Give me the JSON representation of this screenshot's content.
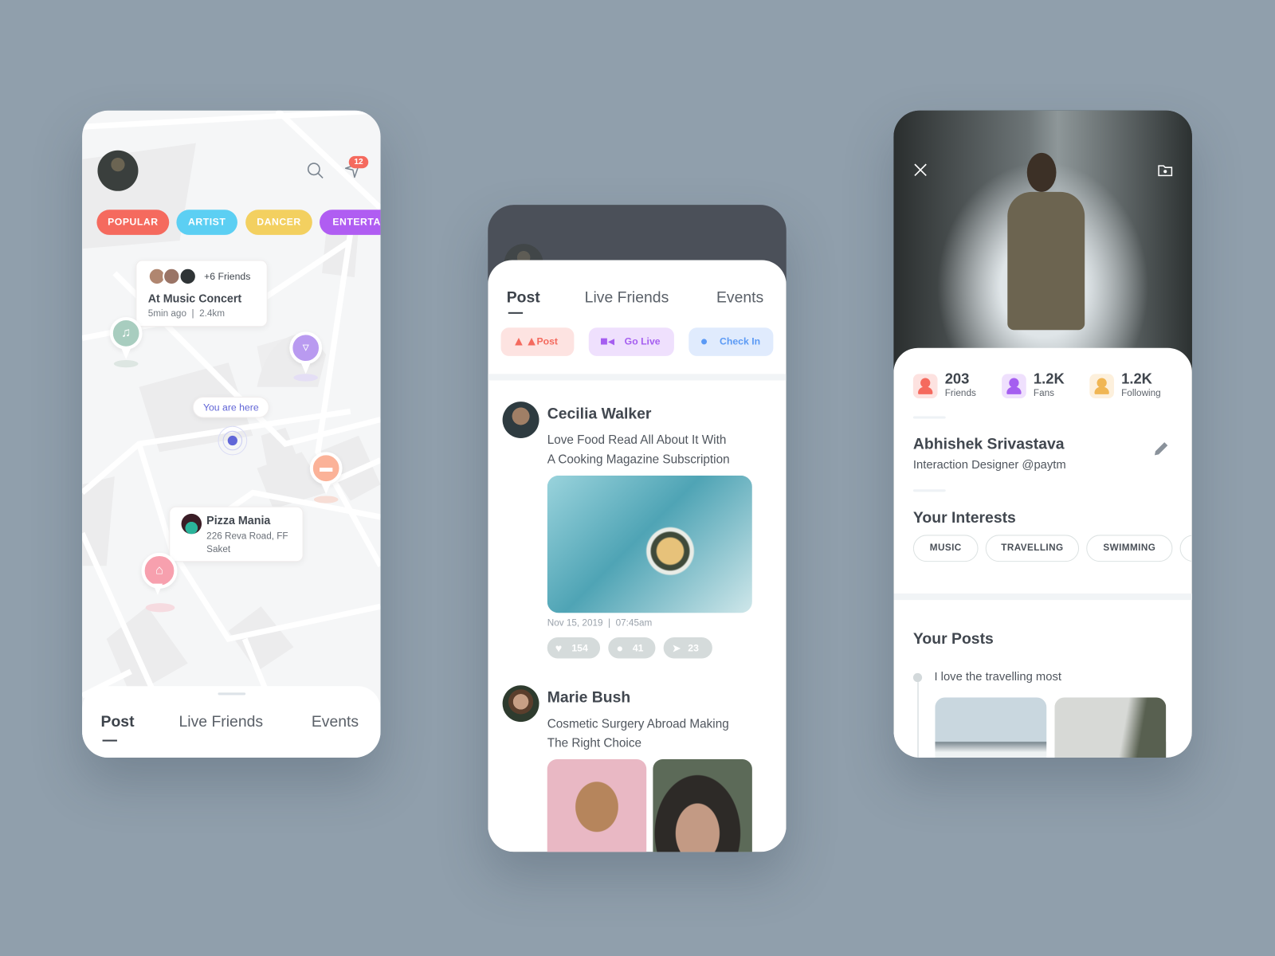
{
  "map_screen": {
    "notification_count": "12",
    "categories": [
      {
        "label": "POPULAR",
        "color": "#f56a5e"
      },
      {
        "label": "ARTIST",
        "color": "#5ccff3"
      },
      {
        "label": "DANCER",
        "color": "#f3d060"
      },
      {
        "label": "ENTERTAN",
        "color": "#b05df2"
      }
    ],
    "friends_card": {
      "extra_friends": "+6 Friends",
      "title": "At Music Concert",
      "meta": "5min ago  |  2.4km"
    },
    "you_are_here": "You are here",
    "place_card": {
      "title": "Pizza Mania",
      "address_line1": "226 Reva Road, FF",
      "address_line2": "Saket"
    },
    "tabs": [
      "Post",
      "Live Friends",
      "Events"
    ],
    "active_tab": "Post"
  },
  "feed_screen": {
    "tabs": [
      "Post",
      "Live Friends",
      "Events"
    ],
    "active_tab": "Post",
    "actions": [
      {
        "label": "Post",
        "icon": "mountain-icon",
        "color": "#f46a5e",
        "bg": "#fde3e1"
      },
      {
        "label": "Go Live",
        "icon": "video-icon",
        "color": "#a55ef0",
        "bg": "#efe0fd"
      },
      {
        "label": "Check In",
        "icon": "location-pin-icon",
        "color": "#5b9af5",
        "bg": "#e0ebfd"
      }
    ],
    "posts": [
      {
        "author": "Cecilia Walker",
        "text_line1": "Love Food Read All About It With",
        "text_line2": "A Cooking Magazine Subscription",
        "date": "Nov 15, 2019  |  07:45am",
        "likes": "154",
        "comments": "41",
        "shares": "23"
      },
      {
        "author": "Marie Bush",
        "text_line1": "Cosmetic Surgery Abroad Making",
        "text_line2": "The Right Choice"
      }
    ]
  },
  "profile_screen": {
    "stats": [
      {
        "value": "203",
        "label": "Friends",
        "color": "#f56a5e",
        "bg": "#fde2e0"
      },
      {
        "value": "1.2K",
        "label": "Fans",
        "color": "#a55ef0",
        "bg": "#efe0fd"
      },
      {
        "value": "1.2K",
        "label": "Following",
        "color": "#f0b654",
        "bg": "#fdf0dc"
      }
    ],
    "name": "Abhishek Srivastava",
    "bio": "Interaction Designer @paytm",
    "interests_title": "Your Interests",
    "interests": [
      "MUSIC",
      "TRAVELLING",
      "SWIMMING"
    ],
    "posts_title": "Your Posts",
    "post_caption": "I love the travelling most"
  }
}
